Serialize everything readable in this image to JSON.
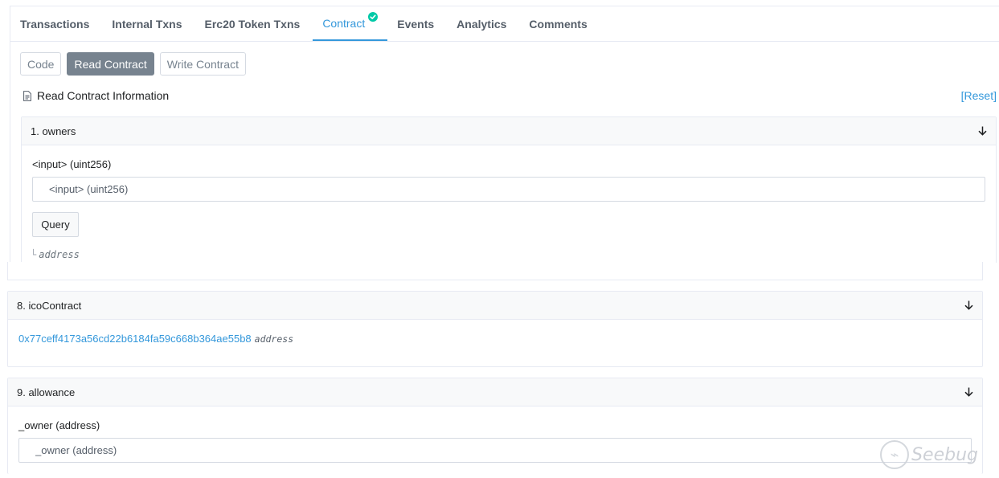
{
  "tabs": [
    {
      "label": "Transactions",
      "active": false
    },
    {
      "label": "Internal Txns",
      "active": false
    },
    {
      "label": "Erc20 Token Txns",
      "active": false
    },
    {
      "label": "Contract",
      "active": true,
      "verified": true
    },
    {
      "label": "Events",
      "active": false
    },
    {
      "label": "Analytics",
      "active": false
    },
    {
      "label": "Comments",
      "active": false
    }
  ],
  "subtabs": [
    {
      "label": "Code",
      "active": false
    },
    {
      "label": "Read Contract",
      "active": true
    },
    {
      "label": "Write Contract",
      "active": false
    }
  ],
  "info": {
    "title": "Read Contract Information",
    "reset": "[Reset]"
  },
  "cards": {
    "owners": {
      "title": "1. owners",
      "input_label": "<input> (uint256)",
      "input_placeholder": "<input> (uint256)",
      "query_label": "Query",
      "return_branch": "└",
      "return_type": "address"
    },
    "icoContract": {
      "title": "8. icoContract",
      "address": "0x77ceff4173a56cd22b6184fa59c668b364ae55b8",
      "type": "address"
    },
    "allowance": {
      "title": "9. allowance",
      "input_label": "_owner (address)",
      "input_placeholder": "_owner (address)"
    }
  },
  "watermark": {
    "text": "Seebug"
  },
  "colors": {
    "accent": "#3498db",
    "verified": "#00c9a7",
    "active_subtab": "#77838f"
  }
}
